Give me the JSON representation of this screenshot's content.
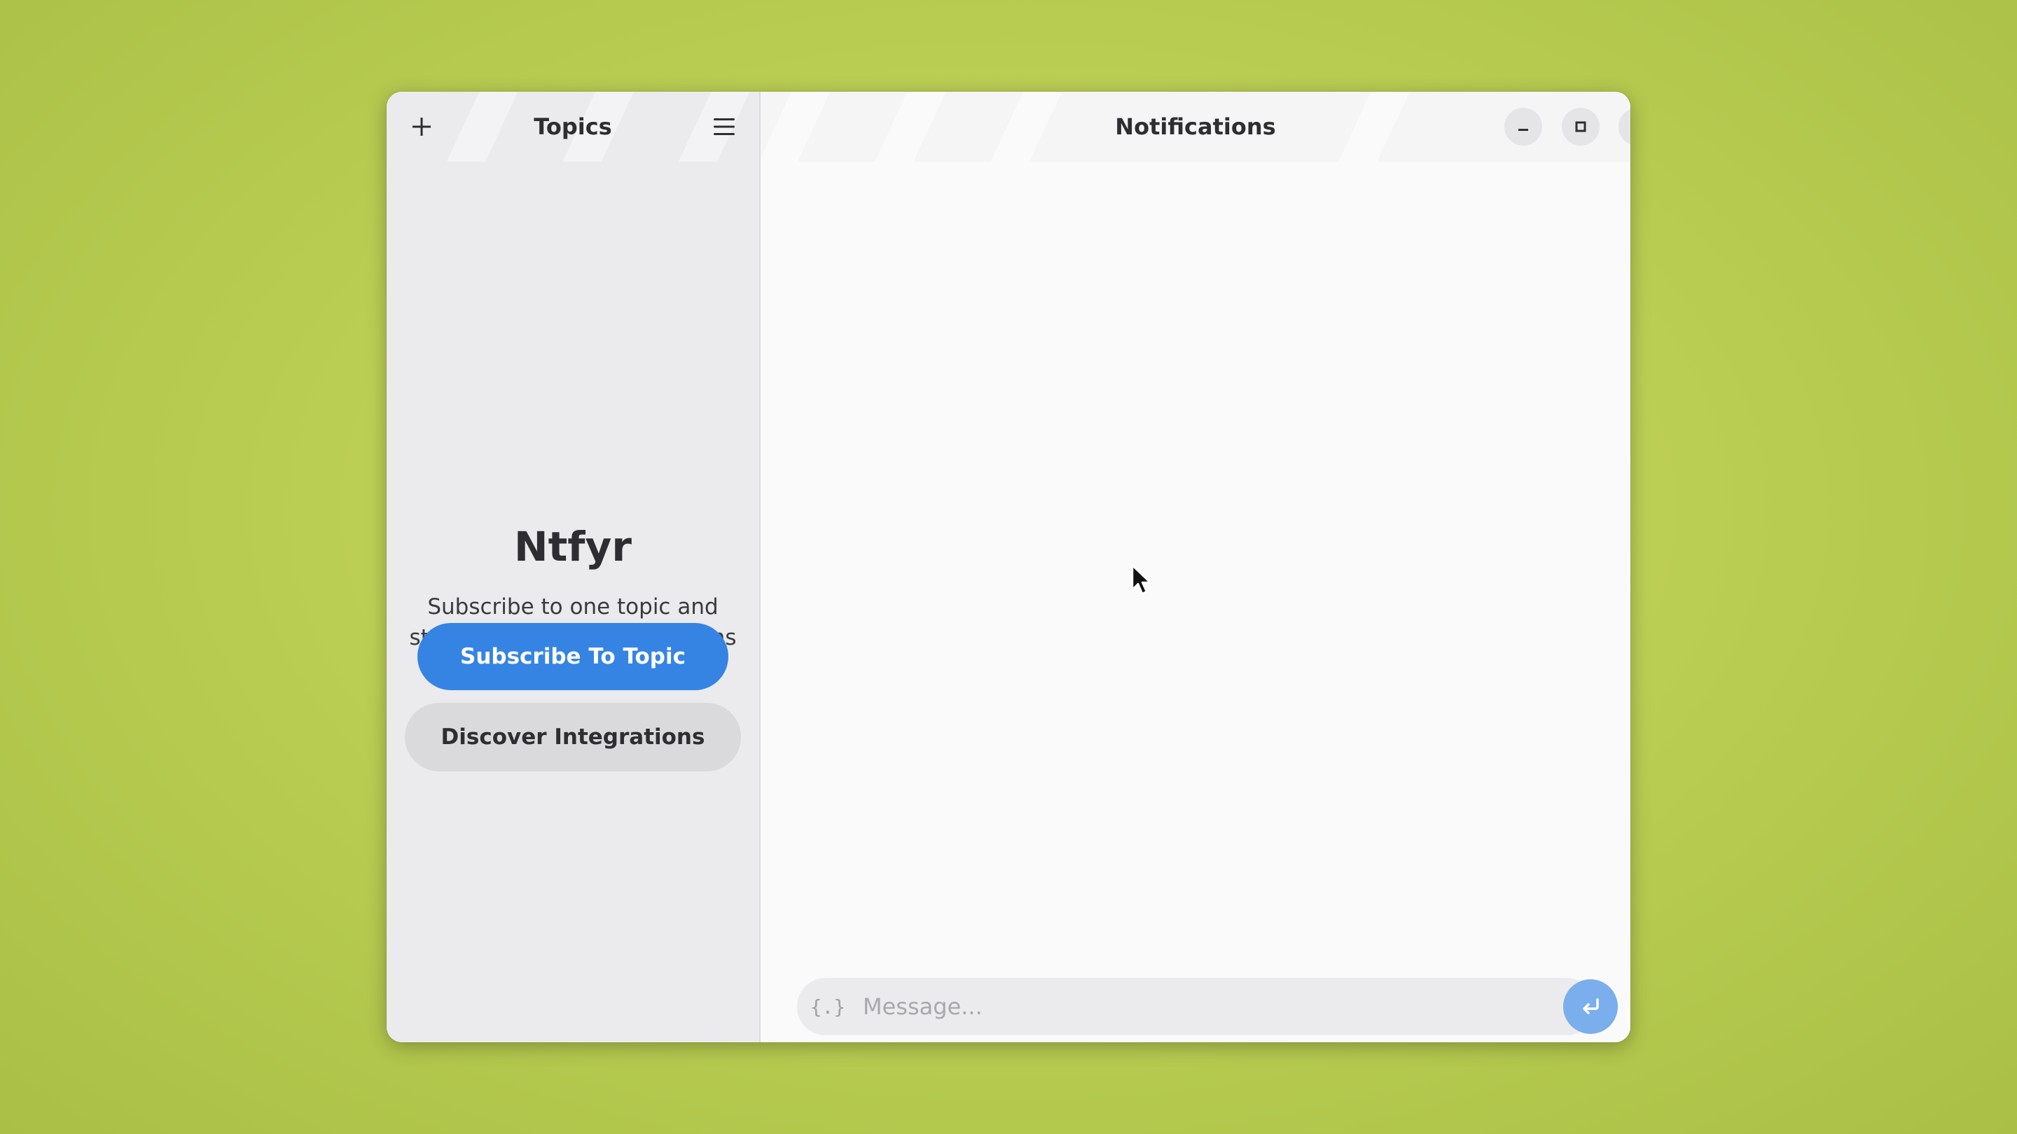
{
  "sidebar": {
    "title": "Topics",
    "add_icon": "plus-icon",
    "menu_icon": "hamburger-menu-icon",
    "empty_state": {
      "app_name": "Ntfyr",
      "description": "Subscribe to one topic and start listening for notifications",
      "subscribe_label": "Subscribe To Topic",
      "discover_label": "Discover Integrations"
    }
  },
  "main": {
    "title": "Notifications",
    "window_controls": {
      "minimize_icon": "minimize-icon",
      "maximize_icon": "maximize-icon",
      "close_icon": "close-icon"
    },
    "composer": {
      "code_icon_label": "{.}",
      "placeholder": "Message...",
      "value": "",
      "send_icon": "enter-icon"
    }
  },
  "colors": {
    "accent": "#3584e4",
    "send_button": "#7aaeec",
    "desktop_background": "#bccf55"
  }
}
